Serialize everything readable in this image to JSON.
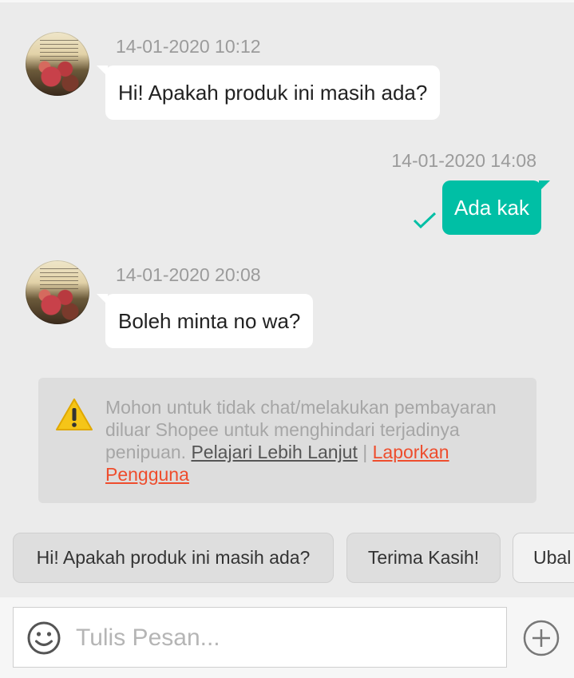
{
  "messages": [
    {
      "direction": "incoming",
      "timestamp": "14-01-2020 10:12",
      "text": "Hi! Apakah produk ini masih ada?"
    },
    {
      "direction": "outgoing",
      "timestamp": "14-01-2020 14:08",
      "text": "Ada kak",
      "status": "sent"
    },
    {
      "direction": "incoming",
      "timestamp": "14-01-2020 20:08",
      "text": "Boleh minta no wa?"
    }
  ],
  "warning": {
    "icon": "warning-icon",
    "text": "Mohon untuk tidak chat/melakukan pembayaran diluar Shopee untuk menghindari terjadinya penipuan.",
    "learn_more": "Pelajari Lebih Lanjut",
    "separator": "|",
    "report_line1": "Laporkan",
    "report_line2": "Pengguna"
  },
  "quick_replies": [
    "Hi! Apakah produk ini masih ada?",
    "Terima Kasih!",
    "Ubal"
  ],
  "composer": {
    "placeholder": "Tulis Pesan...",
    "emoji_icon": "smiley-icon",
    "add_icon": "plus-circle-icon"
  },
  "colors": {
    "accent": "#00bfa5",
    "link_red": "#ee4d2d",
    "warning_yellow": "#f5c518"
  }
}
